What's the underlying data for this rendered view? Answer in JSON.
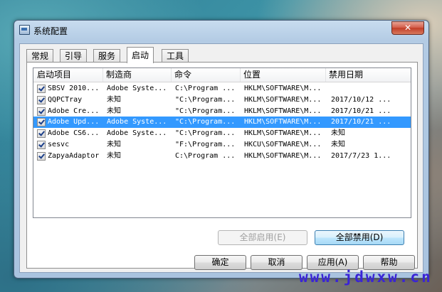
{
  "window": {
    "title": "系统配置",
    "close_glyph": "✕"
  },
  "tabs": [
    {
      "label": "常规"
    },
    {
      "label": "引导"
    },
    {
      "label": "服务"
    },
    {
      "label": "启动",
      "active": true
    },
    {
      "label": "工具"
    }
  ],
  "startup_list": {
    "columns": [
      "启动项目",
      "制造商",
      "命令",
      "位置",
      "禁用日期"
    ],
    "rows": [
      {
        "checked": true,
        "item": "SBSV 2010...",
        "maker": "Adobe Syste...",
        "command": "C:\\Program ...",
        "location": "HKLM\\SOFTWARE\\M...",
        "date": ""
      },
      {
        "checked": true,
        "item": "QQPCTray",
        "maker": "未知",
        "command": "\"C:\\Program...",
        "location": "HKLM\\SOFTWARE\\M...",
        "date": "2017/10/12 ..."
      },
      {
        "checked": true,
        "item": "Adobe Cre...",
        "maker": "未知",
        "command": "\"C:\\Program...",
        "location": "HKLM\\SOFTWARE\\M...",
        "date": "2017/10/21 ..."
      },
      {
        "checked": true,
        "item": "Adobe Upd...",
        "maker": "Adobe Syste...",
        "command": "\"C:\\Program...",
        "location": "HKLM\\SOFTWARE\\M...",
        "date": "2017/10/21 ...",
        "selected": true
      },
      {
        "checked": true,
        "item": "Adobe CS6...",
        "maker": "Adobe Syste...",
        "command": "\"C:\\Program...",
        "location": "HKLM\\SOFTWARE\\M...",
        "date": "未知"
      },
      {
        "checked": true,
        "item": "sesvc",
        "maker": "未知",
        "command": "\"F:\\Program...",
        "location": "HKCU\\SOFTWARE\\M...",
        "date": "未知"
      },
      {
        "checked": true,
        "item": "ZapyaAdaptor",
        "maker": "未知",
        "command": "C:\\Program ...",
        "location": "HKLM\\SOFTWARE\\M...",
        "date": "2017/7/23 1..."
      }
    ]
  },
  "buttons": {
    "enable_all": "全部启用(E)",
    "disable_all": "全部禁用(D)",
    "ok": "确定",
    "cancel": "取消",
    "apply": "应用(A)",
    "help": "帮助"
  },
  "watermark": "www.jdwxw.cn"
}
